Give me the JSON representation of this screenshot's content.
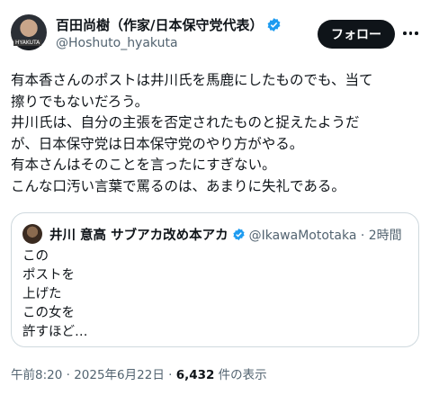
{
  "author": {
    "display_name": "百田尚樹（作家/日本保守党代表）",
    "handle": "@Hoshuto_hyakuta",
    "avatar_badge": "HYAKUTA"
  },
  "actions": {
    "follow_label": "フォロー"
  },
  "post": {
    "lines": [
      "有本香さんのポストは井川氏を馬鹿にしたものでも、当て",
      "擦りでもないだろう。",
      "井川氏は、自分の主張を否定されたものと捉えたようだ",
      "が、日本保守党は日本保守党のやり方がやる。",
      "有本さんはそのことを言ったにすぎない。",
      "こんな口汚い言葉で罵るのは、あまりに失礼である。"
    ]
  },
  "quote": {
    "display_name": "井川 意高 サブアカ改め本アカ",
    "handle_time": "@IkawaMototaka · 2時間",
    "lines": [
      "この",
      "ポストを",
      "上げた",
      "この女を",
      "許すほど…"
    ]
  },
  "meta": {
    "time": "午前8:20 · 2025年6月22日 · ",
    "views": "6,432",
    "views_label": " 件の表示"
  },
  "colors": {
    "verified": "#1d9bf0",
    "secondary_text": "#536471",
    "follow_bg": "#0f1419"
  }
}
